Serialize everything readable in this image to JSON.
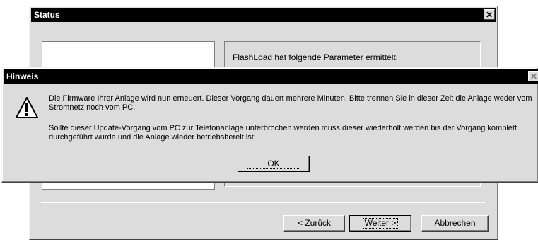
{
  "status_window": {
    "title": "Status",
    "close_glyph": "✕",
    "params_label": "FlashLoad hat folgende Parameter ermittelt:",
    "buttons": {
      "back_prefix": "< ",
      "back_underlined": "Z",
      "back_rest": "urück",
      "next_underlined": "W",
      "next_rest": "eiter >",
      "cancel": "Abbrechen"
    }
  },
  "hinweis_dialog": {
    "title": "Hinweis",
    "close_glyph": "✕",
    "icon": "exclamation-icon",
    "message1": "Die Firmware Ihrer Anlage wird nun erneuert. Dieser Vorgang dauert mehrere Minuten. Bitte trennen Sie in dieser Zeit die Anlage weder vom Stromnetz noch vom PC.",
    "message2": "Sollte dieser Update-Vorgang vom PC zur Telefonanlage unterbrochen werden muss dieser wiederholt werden bis der Vorgang komplett durchgeführt wurde und die Anlage wieder betriebsbereit ist!",
    "ok": "OK"
  }
}
